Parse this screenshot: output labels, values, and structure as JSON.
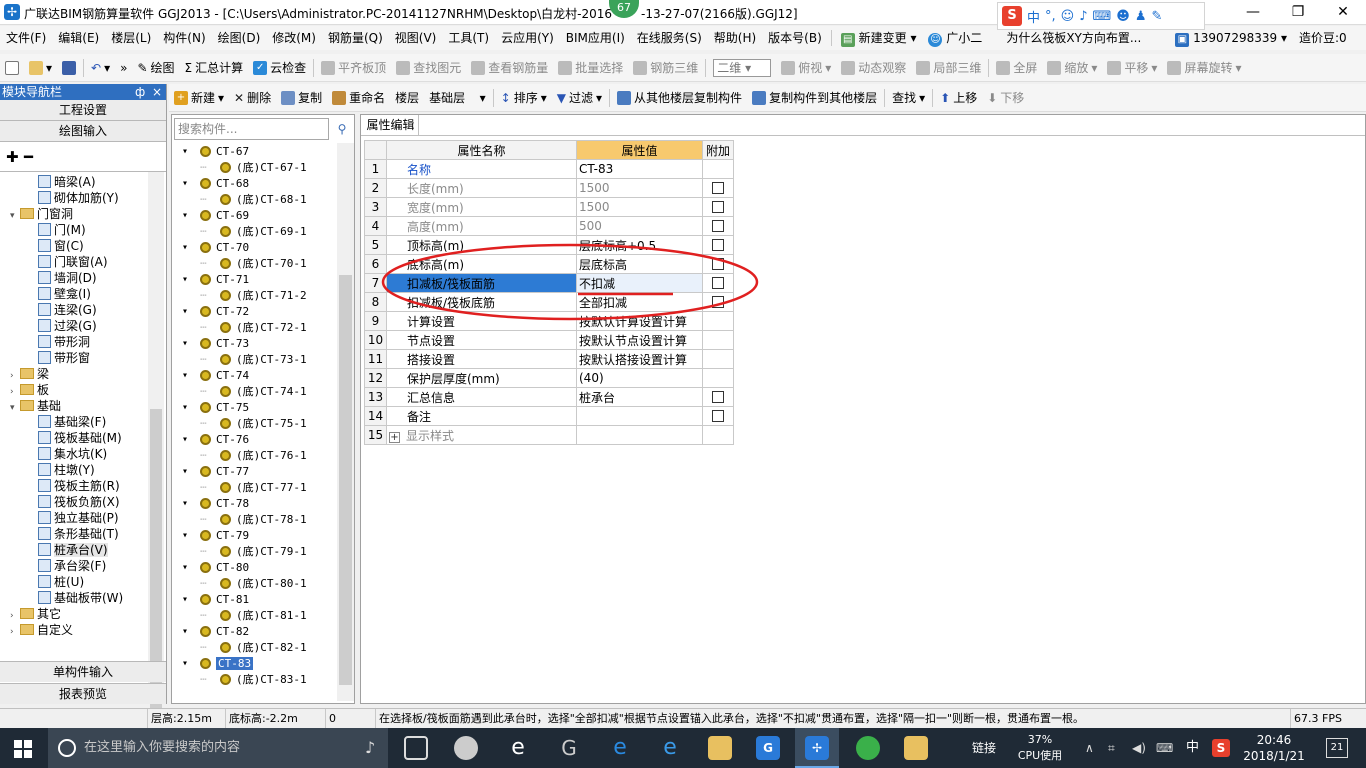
{
  "window": {
    "title": "广联达BIM钢筋算量软件 GGJ2013 - [C:\\Users\\Administrator.PC-20141127NRHM\\Desktop\\白龙村-2016",
    "title_tail": "-13-27-07(2166版).GGJ12]",
    "badge": "67"
  },
  "ime": {
    "lang": "中"
  },
  "menu": [
    "文件(F)",
    "编辑(E)",
    "楼层(L)",
    "构件(N)",
    "绘图(D)",
    "修改(M)",
    "钢筋量(Q)",
    "视图(V)",
    "工具(T)",
    "云应用(Y)",
    "BIM应用(I)",
    "在线服务(S)",
    "帮助(H)",
    "版本号(B)",
    "新建变更",
    "广小二",
    "为什么筏板XY方向布置...",
    "13907298339",
    "造价豆:0"
  ],
  "toolbar1": {
    "draw": "绘图",
    "sum": "汇总计算",
    "cloud": "云检查",
    "flat": "平齐板顶",
    "find": "查找图元",
    "view": "查看钢筋量",
    "batch": "批量选择",
    "rebar3d": "钢筋三维",
    "mode": "二维",
    "top": "俯视",
    "dynamic": "动态观察",
    "local3d": "局部三维",
    "full": "全屏",
    "zoom": "缩放",
    "pan": "平移",
    "rotate": "屏幕旋转"
  },
  "toolbar2": {
    "new": "新建",
    "delete": "删除",
    "copy": "复制",
    "rename": "重命名",
    "floor_label": "楼层",
    "floor_value": "基础层",
    "sort": "排序",
    "filter": "过滤",
    "copy_from": "从其他楼层复制构件",
    "copy_to": "复制构件到其他楼层",
    "find": "查找",
    "up": "上移",
    "down": "下移"
  },
  "nav": {
    "header": "模块导航栏",
    "pin": "ф",
    "close": "×",
    "project_settings": "工程设置",
    "drawing_input": "绘图输入",
    "single_input": "单构件输入",
    "report": "报表预览",
    "tree": [
      {
        "label": "暗梁(A)",
        "indent": 3,
        "kind": "item"
      },
      {
        "label": "砌体加筋(Y)",
        "indent": 3,
        "kind": "item"
      },
      {
        "label": "门窗洞",
        "indent": 1,
        "kind": "folder",
        "exp": "▾"
      },
      {
        "label": "门(M)",
        "indent": 3,
        "kind": "item"
      },
      {
        "label": "窗(C)",
        "indent": 3,
        "kind": "item"
      },
      {
        "label": "门联窗(A)",
        "indent": 3,
        "kind": "item"
      },
      {
        "label": "墙洞(D)",
        "indent": 3,
        "kind": "item"
      },
      {
        "label": "壁龛(I)",
        "indent": 3,
        "kind": "item"
      },
      {
        "label": "连梁(G)",
        "indent": 3,
        "kind": "item"
      },
      {
        "label": "过梁(G)",
        "indent": 3,
        "kind": "item"
      },
      {
        "label": "带形洞",
        "indent": 3,
        "kind": "item"
      },
      {
        "label": "带形窗",
        "indent": 3,
        "kind": "item"
      },
      {
        "label": "梁",
        "indent": 1,
        "kind": "folder",
        "exp": "›"
      },
      {
        "label": "板",
        "indent": 1,
        "kind": "folder",
        "exp": "›"
      },
      {
        "label": "基础",
        "indent": 1,
        "kind": "folder",
        "exp": "▾"
      },
      {
        "label": "基础梁(F)",
        "indent": 3,
        "kind": "item"
      },
      {
        "label": "筏板基础(M)",
        "indent": 3,
        "kind": "item"
      },
      {
        "label": "集水坑(K)",
        "indent": 3,
        "kind": "item"
      },
      {
        "label": "柱墩(Y)",
        "indent": 3,
        "kind": "item"
      },
      {
        "label": "筏板主筋(R)",
        "indent": 3,
        "kind": "item"
      },
      {
        "label": "筏板负筋(X)",
        "indent": 3,
        "kind": "item"
      },
      {
        "label": "独立基础(P)",
        "indent": 3,
        "kind": "item"
      },
      {
        "label": "条形基础(T)",
        "indent": 3,
        "kind": "item"
      },
      {
        "label": "桩承台(V)",
        "indent": 3,
        "kind": "item",
        "sel": true
      },
      {
        "label": "承台梁(F)",
        "indent": 3,
        "kind": "item"
      },
      {
        "label": "桩(U)",
        "indent": 3,
        "kind": "item"
      },
      {
        "label": "基础板带(W)",
        "indent": 3,
        "kind": "item"
      },
      {
        "label": "其它",
        "indent": 1,
        "kind": "folder",
        "exp": "›"
      },
      {
        "label": "自定义",
        "indent": 1,
        "kind": "folder",
        "exp": "›"
      }
    ]
  },
  "components": {
    "search_placeholder": "搜索构件...",
    "items": [
      {
        "label": "CT-67",
        "level": 0
      },
      {
        "label": "(底)CT-67-1",
        "level": 1
      },
      {
        "label": "CT-68",
        "level": 0
      },
      {
        "label": "(底)CT-68-1",
        "level": 1
      },
      {
        "label": "CT-69",
        "level": 0
      },
      {
        "label": "(底)CT-69-1",
        "level": 1
      },
      {
        "label": "CT-70",
        "level": 0
      },
      {
        "label": "(底)CT-70-1",
        "level": 1
      },
      {
        "label": "CT-71",
        "level": 0
      },
      {
        "label": "(底)CT-71-2",
        "level": 1
      },
      {
        "label": "CT-72",
        "level": 0
      },
      {
        "label": "(底)CT-72-1",
        "level": 1
      },
      {
        "label": "CT-73",
        "level": 0
      },
      {
        "label": "(底)CT-73-1",
        "level": 1
      },
      {
        "label": "CT-74",
        "level": 0
      },
      {
        "label": "(底)CT-74-1",
        "level": 1
      },
      {
        "label": "CT-75",
        "level": 0
      },
      {
        "label": "(底)CT-75-1",
        "level": 1
      },
      {
        "label": "CT-76",
        "level": 0
      },
      {
        "label": "(底)CT-76-1",
        "level": 1
      },
      {
        "label": "CT-77",
        "level": 0
      },
      {
        "label": "(底)CT-77-1",
        "level": 1
      },
      {
        "label": "CT-78",
        "level": 0
      },
      {
        "label": "(底)CT-78-1",
        "level": 1
      },
      {
        "label": "CT-79",
        "level": 0
      },
      {
        "label": "(底)CT-79-1",
        "level": 1
      },
      {
        "label": "CT-80",
        "level": 0
      },
      {
        "label": "(底)CT-80-1",
        "level": 1
      },
      {
        "label": "CT-81",
        "level": 0
      },
      {
        "label": "(底)CT-81-1",
        "level": 1
      },
      {
        "label": "CT-82",
        "level": 0
      },
      {
        "label": "(底)CT-82-1",
        "level": 1
      },
      {
        "label": "CT-83",
        "level": 0,
        "sel": true
      },
      {
        "label": "(底)CT-83-1",
        "level": 1
      }
    ]
  },
  "props": {
    "tab": "属性编辑",
    "headers": {
      "name": "属性名称",
      "value": "属性值",
      "add": "附加"
    },
    "rows": [
      {
        "n": "1",
        "name": "名称",
        "value": "CT-83",
        "chk": false,
        "style": "blue"
      },
      {
        "n": "2",
        "name": "长度(mm)",
        "value": "1500",
        "chk": true,
        "style": "gray"
      },
      {
        "n": "3",
        "name": "宽度(mm)",
        "value": "1500",
        "chk": true,
        "style": "gray"
      },
      {
        "n": "4",
        "name": "高度(mm)",
        "value": "500",
        "chk": true,
        "style": "gray"
      },
      {
        "n": "5",
        "name": "顶标高(m)",
        "value": "层底标高+0.5",
        "chk": true,
        "style": ""
      },
      {
        "n": "6",
        "name": "底标高(m)",
        "value": "层底标高",
        "chk": true,
        "style": ""
      },
      {
        "n": "7",
        "name": "扣减板/筏板面筋",
        "value": "不扣减",
        "chk": true,
        "style": "",
        "sel": true
      },
      {
        "n": "8",
        "name": "扣减板/筏板底筋",
        "value": "全部扣减",
        "chk": true,
        "style": ""
      },
      {
        "n": "9",
        "name": "计算设置",
        "value": "按默认计算设置计算",
        "chk": false,
        "style": ""
      },
      {
        "n": "10",
        "name": "节点设置",
        "value": "按默认节点设置计算",
        "chk": false,
        "style": ""
      },
      {
        "n": "11",
        "name": "搭接设置",
        "value": "按默认搭接设置计算",
        "chk": false,
        "style": ""
      },
      {
        "n": "12",
        "name": "保护层厚度(mm)",
        "value": "(40)",
        "chk": false,
        "style": ""
      },
      {
        "n": "13",
        "name": "汇总信息",
        "value": "桩承台",
        "chk": true,
        "style": ""
      },
      {
        "n": "14",
        "name": "备注",
        "value": "",
        "chk": true,
        "style": ""
      },
      {
        "n": "15",
        "name": "显示样式",
        "value": "",
        "chk": false,
        "style": "gray",
        "expander": "+"
      }
    ]
  },
  "status": {
    "floor_height": "层高:2.15m",
    "bottom_elev": "底标高:-2.2m",
    "zero": "0",
    "hint": "在选择板/筏板面筋遇到此承台时，选择\"全部扣减\"根据节点设置锚入此承台，选择\"不扣减\"贯通布置，选择\"隔一扣一\"则断一根，贯通布置一根。",
    "fps": "67.3 FPS"
  },
  "taskbar": {
    "search_placeholder": "在这里输入你要搜索的内容",
    "link": "链接",
    "cpu_pct": "37%",
    "cpu_label": "CPU使用",
    "lang": "中",
    "time": "20:46",
    "date": "2018/1/21",
    "notif": "21"
  },
  "colors": {
    "accent": "#2f6fc0",
    "annotation": "#e02020",
    "header_value": "#f7c96e"
  }
}
